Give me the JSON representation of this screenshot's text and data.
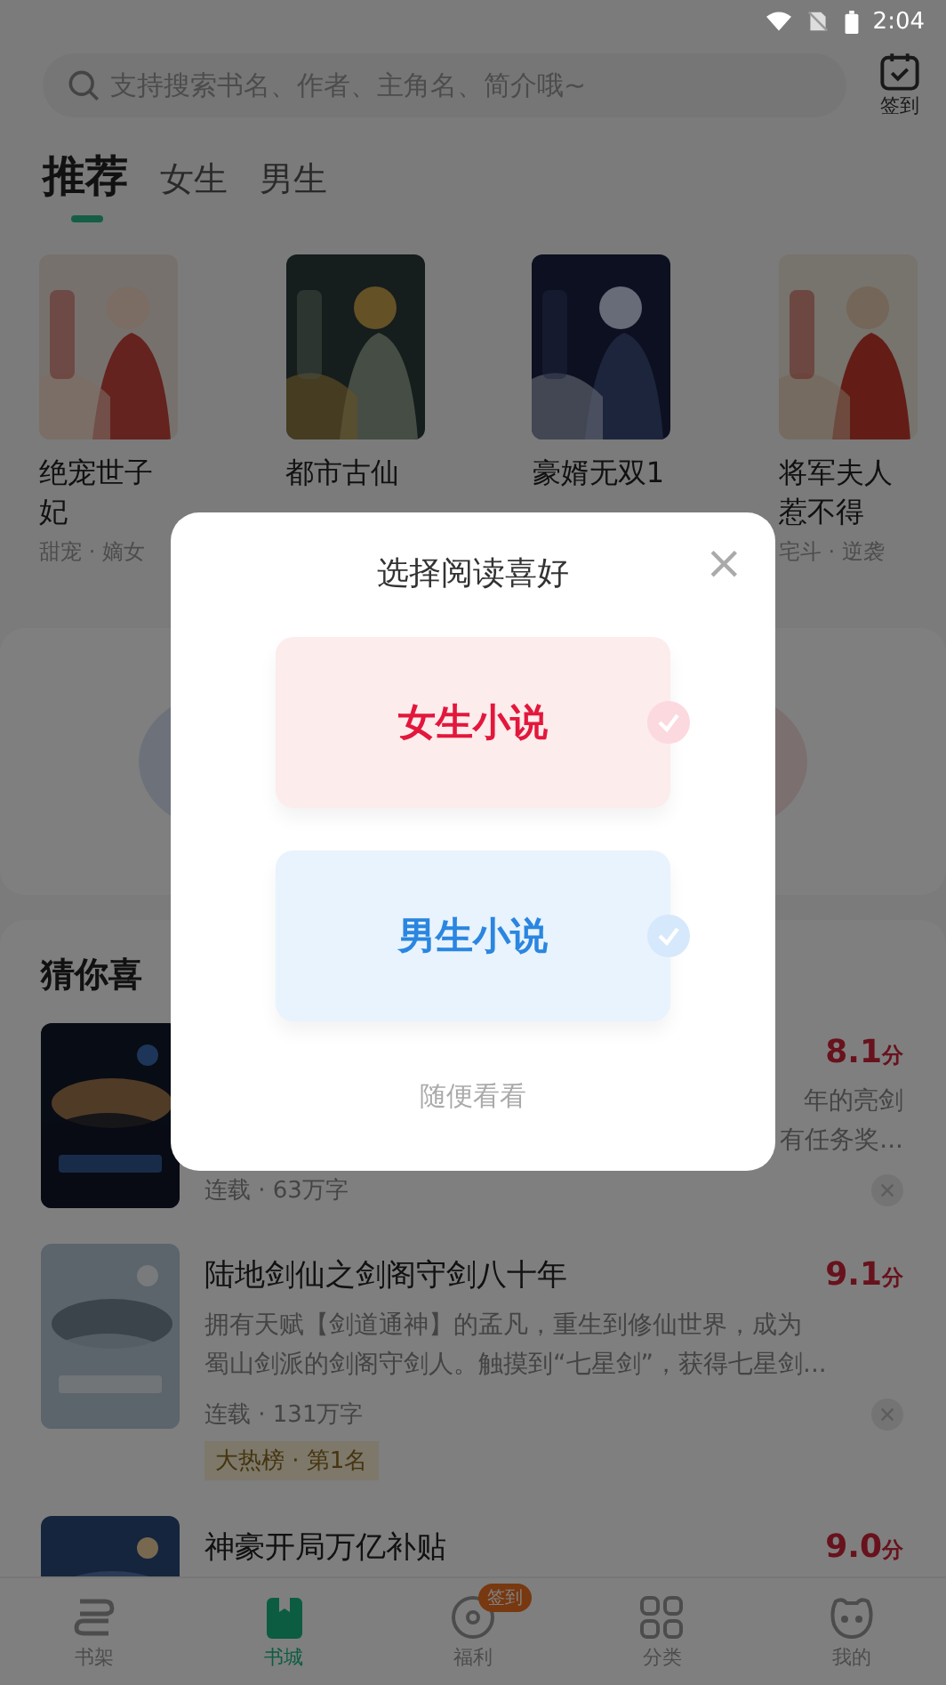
{
  "status_bar": {
    "time": "2:04"
  },
  "search": {
    "placeholder": "支持搜索书名、作者、主角名、简介哦~"
  },
  "checkin": {
    "label": "签到"
  },
  "tabs": [
    {
      "label": "推荐",
      "selected": true
    },
    {
      "label": "女生",
      "selected": false
    },
    {
      "label": "男生",
      "selected": false
    }
  ],
  "featured_books": [
    {
      "title": "绝宠世子妃",
      "tags": "甜宠 · 嫡女"
    },
    {
      "title": "都市古仙"
    },
    {
      "title": "豪婿无双1"
    },
    {
      "title": "将军夫人惹不得",
      "tags": "宅斗 · 逆袭"
    }
  ],
  "recommend": {
    "title": "猜你喜",
    "items": [
      {
        "score": "8.1",
        "unit": "分",
        "description": [
          "年的亮剑",
          "有任务奖..."
        ],
        "meta": "连载 · 63万字"
      },
      {
        "title": "陆地剑仙之剑阁守剑八十年",
        "score": "9.1",
        "unit": "分",
        "description": [
          "拥有天赋【剑道通神】的孟凡，重生到修仙世界，成为",
          "蜀山剑派的剑阁守剑人。触摸到“七星剑”，获得七星剑..."
        ],
        "meta": "连载 · 131万字",
        "rank": "大热榜 · 第1名"
      },
      {
        "title": "神豪开局万亿补贴",
        "score": "9.0",
        "unit": "分"
      }
    ]
  },
  "bottom_nav": [
    {
      "label": "书架",
      "selected": false
    },
    {
      "label": "书城",
      "selected": true
    },
    {
      "label": "福利",
      "selected": false,
      "badge": "签到"
    },
    {
      "label": "分类",
      "selected": false
    },
    {
      "label": "我的",
      "selected": false
    }
  ],
  "dialog": {
    "title": "选择阅读喜好",
    "close": "×",
    "options": [
      {
        "kind": "female",
        "label": "女生小说",
        "selected": false
      },
      {
        "kind": "male",
        "label": "男生小说",
        "selected": false
      }
    ],
    "skip": "随便看看"
  }
}
